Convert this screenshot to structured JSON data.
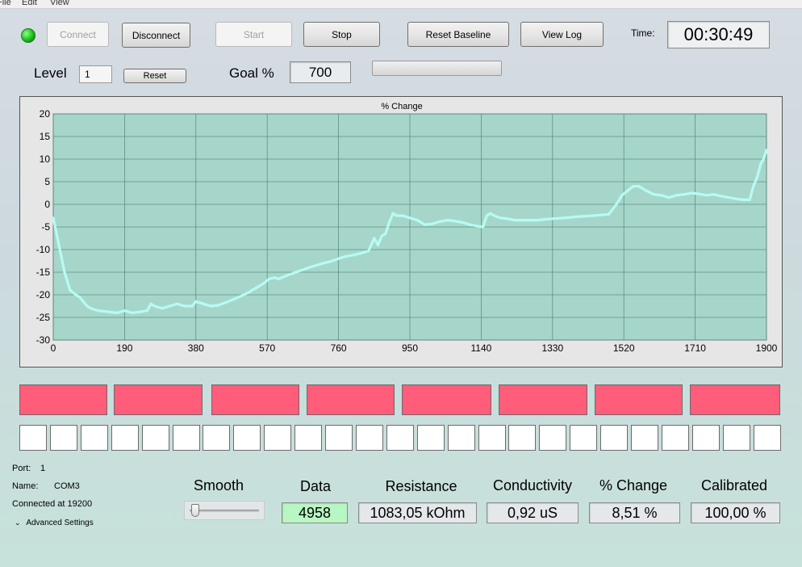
{
  "menu": [
    "File",
    "Edit",
    "View"
  ],
  "status_led_color": "#16c016",
  "toolbar": {
    "connect_label": "Connect",
    "disconnect_label": "Disconnect",
    "start_label": "Start",
    "stop_label": "Stop",
    "reset_baseline_label": "Reset Baseline",
    "view_log_label": "View Log",
    "time_label": "Time:",
    "time_value": "00:30:49"
  },
  "level": {
    "label": "Level",
    "value": "1",
    "reset_label": "Reset"
  },
  "goal": {
    "label": "Goal %",
    "value": "700",
    "progress": 0
  },
  "chart_data": {
    "type": "line",
    "title": "% Change",
    "xlim": [
      0,
      1900
    ],
    "ylim": [
      -30,
      20
    ],
    "x_ticks": [
      0,
      190,
      380,
      570,
      760,
      950,
      1140,
      1330,
      1520,
      1710,
      1900
    ],
    "y_ticks": [
      20,
      15,
      10,
      5,
      0,
      -5,
      -10,
      -15,
      -20,
      -25,
      -30
    ],
    "grid": true,
    "background_color": "#a6d6ca",
    "line_color": "#b7fbf3",
    "series": [
      {
        "x": [
          0,
          10,
          20,
          30,
          45,
          60,
          70,
          80,
          90,
          100,
          120,
          150,
          170,
          190,
          210,
          230,
          250,
          260,
          270,
          290,
          310,
          330,
          350,
          370,
          380,
          400,
          420,
          440,
          460,
          480,
          500,
          520,
          540,
          560,
          575,
          590,
          600,
          620,
          640,
          660,
          680,
          700,
          720,
          740,
          760,
          780,
          800,
          820,
          840,
          855,
          865,
          875,
          885,
          895,
          905,
          915,
          930,
          950,
          970,
          990,
          1010,
          1030,
          1050,
          1070,
          1090,
          1110,
          1130,
          1145,
          1155,
          1165,
          1175,
          1190,
          1210,
          1230,
          1250,
          1270,
          1290,
          1310,
          1330,
          1360,
          1400,
          1440,
          1480,
          1500,
          1515,
          1530,
          1545,
          1560,
          1580,
          1600,
          1620,
          1640,
          1660,
          1680,
          1700,
          1720,
          1740,
          1760,
          1780,
          1800,
          1820,
          1840,
          1855,
          1865,
          1875,
          1885,
          1892,
          1900
        ],
        "y": [
          -3,
          -7,
          -11,
          -15,
          -19,
          -20,
          -20.5,
          -21.5,
          -22.5,
          -23,
          -23.5,
          -23.8,
          -24,
          -23.5,
          -24,
          -23.8,
          -23.5,
          -22,
          -22.5,
          -23,
          -22.5,
          -22,
          -22.5,
          -22.5,
          -21.5,
          -22,
          -22.5,
          -22.3,
          -21.7,
          -21,
          -20.3,
          -19.5,
          -18.5,
          -17.5,
          -16.5,
          -16.2,
          -16.5,
          -15.8,
          -15.2,
          -14.6,
          -14,
          -13.5,
          -13,
          -12.6,
          -12,
          -11.5,
          -11.2,
          -10.8,
          -10.3,
          -7.5,
          -9,
          -7,
          -6.5,
          -4,
          -2,
          -2.5,
          -2.5,
          -3,
          -3.5,
          -4.5,
          -4.3,
          -3.8,
          -3.5,
          -3.7,
          -4,
          -4.5,
          -4.8,
          -5,
          -2.5,
          -2,
          -2.5,
          -3,
          -3.2,
          -3.5,
          -3.5,
          -3.5,
          -3.5,
          -3.3,
          -3.2,
          -3,
          -2.7,
          -2.5,
          -2.2,
          0,
          2,
          3,
          4,
          4,
          3,
          2.2,
          2,
          1.5,
          2,
          2.2,
          2.5,
          2.3,
          2,
          2.2,
          1.8,
          1.5,
          1.2,
          1,
          1,
          4,
          6,
          9,
          10,
          12
        ]
      }
    ]
  },
  "indicators": {
    "bar_color": "#ff5d7a",
    "bars": 8,
    "boxes": 25
  },
  "info": {
    "port_label": "Port:",
    "port_value": "1",
    "name_label": "Name:",
    "name_value": "COM3",
    "connected_text": "Connected at 19200",
    "advanced_label": "Advanced Settings"
  },
  "metrics": {
    "smooth_label": "Smooth",
    "smooth_level": 0.05,
    "data_label": "Data",
    "data_value": "4958",
    "data_color": "#b8f7c4",
    "resistance_label": "Resistance",
    "resistance_value": "1083,05 kOhm",
    "conductivity_label": "Conductivity",
    "conductivity_value": "0,92 uS",
    "change_label": "% Change",
    "change_value": "8,51 %",
    "calibrated_label": "Calibrated",
    "calibrated_value": "100,00 %"
  }
}
